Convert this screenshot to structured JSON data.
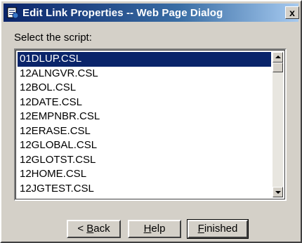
{
  "window": {
    "title": "Edit Link Properties -- Web Page Dialog",
    "close_label": "x",
    "title_icon": "page-icon"
  },
  "prompt": {
    "label": "Select the script:"
  },
  "script_list": {
    "selected_index": 0,
    "items": [
      "01DLUP.CSL",
      "12ALNGVR.CSL",
      "12BOL.CSL",
      "12DATE.CSL",
      "12EMPNBR.CSL",
      "12ERASE.CSL",
      "12GLOBAL.CSL",
      "12GLOTST.CSL",
      "12HOME.CSL",
      "12JGTEST.CSL"
    ]
  },
  "buttons": {
    "back": {
      "prefix": "< ",
      "mnemonic": "B",
      "rest": "ack"
    },
    "help": {
      "prefix": "",
      "mnemonic": "H",
      "rest": "elp"
    },
    "finished": {
      "prefix": "",
      "mnemonic": "F",
      "rest": "inished"
    }
  },
  "colors": {
    "selection": "#0a246a",
    "dialog_face": "#d4d0c8"
  }
}
